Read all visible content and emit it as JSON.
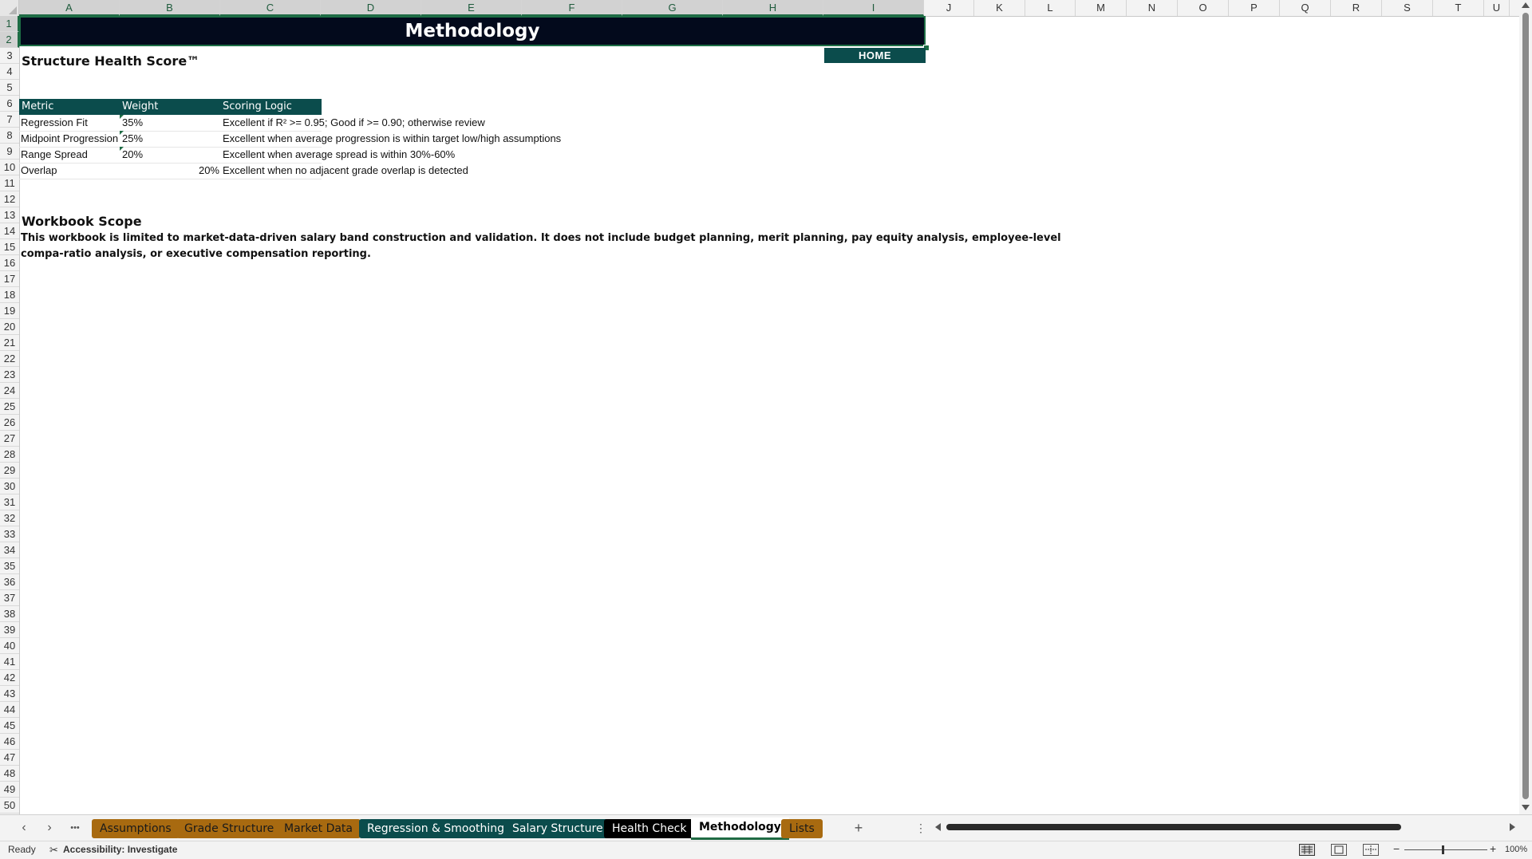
{
  "columns": [
    "A",
    "B",
    "C",
    "D",
    "E",
    "F",
    "G",
    "H",
    "I",
    "J",
    "K",
    "L",
    "M",
    "N",
    "O",
    "P",
    "Q",
    "R",
    "S",
    "T",
    "U"
  ],
  "rows": [
    "1",
    "2",
    "3",
    "4",
    "5",
    "6",
    "7",
    "8",
    "9",
    "10",
    "11",
    "12",
    "13",
    "14",
    "15",
    "16",
    "17",
    "18",
    "19",
    "20",
    "21",
    "22",
    "23",
    "24",
    "25",
    "26",
    "27",
    "28",
    "29",
    "30",
    "31",
    "32",
    "33",
    "34",
    "35",
    "36",
    "37",
    "38",
    "39",
    "40",
    "41",
    "42",
    "43",
    "44",
    "45",
    "46",
    "47",
    "48",
    "49",
    "50"
  ],
  "sheet": {
    "title": "Methodology",
    "home_button": "HOME",
    "health_heading": "Structure Health Score™",
    "table": {
      "headers": [
        "Metric",
        "Weight",
        "Scoring Logic"
      ],
      "rows": [
        {
          "metric": "Regression Fit",
          "weight": "35%",
          "logic": "Excellent if R² >= 0.95; Good if >= 0.90; otherwise review"
        },
        {
          "metric": "Midpoint Progression",
          "weight": "25%",
          "logic": "Excellent when average progression is within target low/high assumptions"
        },
        {
          "metric": "Range Spread",
          "weight": "20%",
          "logic": "Excellent when average spread is within 30%-60%"
        },
        {
          "metric": "Overlap",
          "weight": "20%",
          "logic": "Excellent when no adjacent grade overlap is detected"
        }
      ]
    },
    "scope_heading": "Workbook Scope",
    "scope_line1": "This workbook is limited to market-data-driven salary band construction and validation. It does not include budget planning, merit planning, pay equity analysis, employee-level",
    "scope_line2": "compa-ratio analysis, or executive compensation reporting."
  },
  "tabs": [
    {
      "label": "Assumptions",
      "style": "gold"
    },
    {
      "label": "Grade Structure",
      "style": "gold"
    },
    {
      "label": "Market Data",
      "style": "gold"
    },
    {
      "label": "Regression & Smoothing",
      "style": "teal"
    },
    {
      "label": "Salary Structure",
      "style": "teal"
    },
    {
      "label": "Health Check",
      "style": "black"
    },
    {
      "label": "Methodology",
      "style": "active"
    },
    {
      "label": "Lists",
      "style": "gold"
    }
  ],
  "tabbar": {
    "more": "•••",
    "add": "+",
    "options": "⋮"
  },
  "status": {
    "ready": "Ready",
    "accessibility": "Accessibility: Investigate",
    "zoom": "100%"
  },
  "colors": {
    "title_bg": "#030a1c",
    "accent_teal": "#0b4c4c",
    "tab_gold": "#a86a10",
    "selection_green": "#1f6b44"
  }
}
